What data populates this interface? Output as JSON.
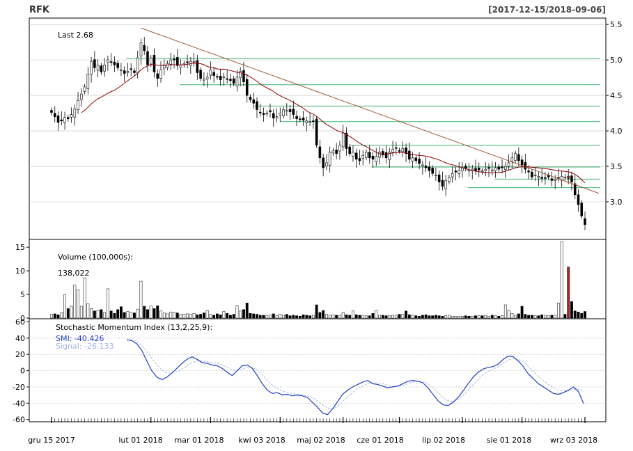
{
  "header": {
    "symbol": "RFK",
    "range": "[2017-12-15/2018-09-06]"
  },
  "chart_data": [
    {
      "type": "candlestick",
      "panel": "price",
      "annotation": "Last 2.68",
      "ylim": [
        2.48,
        5.58
      ],
      "y_ticks": [
        "3.0",
        "3.5",
        "4.0",
        "4.5",
        "5.0",
        "5.5"
      ],
      "x_labels": [
        "gru 15 2017",
        "lut 01 2018",
        "mar 01 2018",
        "kwi 03 2018",
        "maj 02 2018",
        "cze 01 2018",
        "lip 02 2018",
        "sie 01 2018",
        "wrz 03 2018"
      ],
      "closes": [
        4.26,
        4.2,
        4.12,
        4.14,
        4.19,
        4.17,
        4.23,
        4.31,
        4.43,
        4.52,
        4.62,
        4.8,
        4.98,
        4.89,
        4.93,
        4.83,
        4.93,
        5.0,
        4.97,
        4.93,
        4.89,
        4.86,
        4.81,
        4.84,
        4.87,
        4.82,
        5.03,
        5.24,
        5.13,
        4.93,
        5.03,
        4.83,
        4.74,
        4.86,
        4.93,
        4.95,
        5.0,
        5.0,
        4.92,
        4.93,
        4.95,
        4.96,
        4.98,
        4.98,
        4.82,
        4.74,
        4.73,
        4.76,
        4.86,
        4.78,
        4.76,
        4.72,
        4.76,
        4.73,
        4.71,
        4.67,
        4.76,
        4.84,
        4.69,
        4.5,
        4.44,
        4.39,
        4.3,
        4.26,
        4.23,
        4.25,
        4.27,
        4.18,
        4.2,
        4.25,
        4.3,
        4.29,
        4.27,
        4.23,
        4.17,
        4.16,
        4.15,
        4.14,
        4.13,
        4.13,
        3.8,
        3.62,
        3.48,
        3.55,
        3.7,
        3.72,
        3.68,
        3.8,
        3.97,
        3.75,
        3.68,
        3.7,
        3.6,
        3.58,
        3.65,
        3.7,
        3.62,
        3.6,
        3.64,
        3.7,
        3.66,
        3.62,
        3.7,
        3.74,
        3.76,
        3.72,
        3.75,
        3.68,
        3.6,
        3.62,
        3.58,
        3.54,
        3.52,
        3.48,
        3.44,
        3.4,
        3.38,
        3.28,
        3.22,
        3.3,
        3.34,
        3.4,
        3.42,
        3.44,
        3.48,
        3.47,
        3.45,
        3.46,
        3.44,
        3.45,
        3.44,
        3.46,
        3.47,
        3.45,
        3.48,
        3.46,
        3.48,
        3.5,
        3.55,
        3.62,
        3.68,
        3.58,
        3.52,
        3.46,
        3.42,
        3.35,
        3.38,
        3.36,
        3.33,
        3.34,
        3.35,
        3.3,
        3.32,
        3.34,
        3.36,
        3.35,
        3.33,
        3.28,
        3.1,
        2.96,
        2.8,
        2.68
      ],
      "volume_ticks": [
        "0",
        "5",
        "10",
        "15"
      ],
      "volume": {
        "label": "Volume (100,000s):",
        "last": "138,022",
        "ylim": [
          0,
          16.5
        ],
        "values": [
          0.8,
          0.9,
          0.7,
          1.2,
          5.0,
          2.0,
          2.5,
          7.0,
          6.0,
          2.5,
          8.5,
          3.0,
          2.0,
          1.5,
          1.6,
          1.8,
          1.2,
          6.2,
          1.5,
          1.0,
          1.8,
          2.4,
          1.2,
          1.4,
          1.2,
          1.1,
          1.9,
          7.8,
          2.5,
          1.8,
          2.6,
          2.0,
          2.6,
          1.5,
          1.1,
          0.9,
          1.3,
          1.2,
          1.1,
          0.8,
          0.8,
          0.9,
          0.8,
          1.0,
          0.7,
          0.8,
          1.1,
          1.6,
          0.8,
          0.6,
          0.9,
          0.7,
          1.4,
          1.0,
          0.6,
          0.8,
          2.7,
          1.5,
          1.8,
          3.2,
          1.0,
          0.9,
          0.8,
          0.6,
          0.6,
          0.5,
          0.7,
          0.9,
          0.5,
          0.8,
          0.6,
          0.8,
          0.5,
          0.6,
          0.5,
          0.4,
          0.7,
          0.6,
          0.5,
          0.6,
          2.8,
          1.2,
          1.6,
          0.8,
          0.6,
          0.7,
          0.6,
          0.6,
          1.2,
          0.7,
          0.6,
          1.5,
          0.7,
          0.6,
          0.6,
          0.5,
          0.5,
          1.0,
          1.6,
          0.6,
          0.6,
          0.5,
          0.5,
          0.6,
          0.6,
          0.8,
          0.8,
          1.5,
          0.7,
          0.6,
          0.5,
          0.4,
          0.6,
          0.7,
          0.5,
          0.5,
          0.6,
          0.5,
          0.4,
          0.5,
          0.6,
          0.4,
          0.4,
          0.4,
          0.4,
          0.5,
          0.4,
          0.4,
          0.5,
          0.5,
          0.5,
          0.5,
          0.4,
          0.6,
          0.5,
          0.4,
          0.5,
          2.8,
          1.6,
          1.0,
          0.6,
          0.9,
          2.5,
          0.8,
          0.6,
          0.6,
          0.5,
          0.5,
          0.7,
          0.6,
          0.5,
          0.6,
          0.6,
          3.2,
          16.2,
          0.8,
          10.8,
          3.5,
          1.5,
          1.3,
          1.0,
          1.4
        ],
        "up_color": "#ffffff",
        "down_color": "#000000",
        "highlight_color": "#b22222"
      },
      "moving_average": {
        "color": "#8b0000"
      },
      "trendline": {
        "color": "#a0522d"
      },
      "horizontal_levels": [
        {
          "y": 5.02,
          "color": "#3cb371"
        },
        {
          "y": 4.65,
          "color": "#3cb371"
        },
        {
          "y": 4.35,
          "color": "#3cb371"
        },
        {
          "y": 4.13,
          "color": "#3cb371"
        },
        {
          "y": 3.8,
          "color": "#3cb371"
        },
        {
          "y": 3.49,
          "color": "#3cb371"
        },
        {
          "y": 3.32,
          "color": "#3cb371"
        },
        {
          "y": 3.2,
          "color": "#3cb371"
        }
      ],
      "colors": {
        "up": "#ffffff",
        "down": "#000000",
        "red": "#b22222",
        "grid": "#c0c0c0",
        "frame": "#000000"
      }
    },
    {
      "type": "line",
      "panel": "indicator",
      "title": "Stochastic Momentum Index (13,2,25,9):",
      "ylim": [
        -62,
        63
      ],
      "y_ticks": [
        "-60",
        "-40",
        "-20",
        "0",
        "20",
        "40",
        "60"
      ],
      "series": [
        {
          "name": "SMI: -40.426",
          "color": "#1f3fbf",
          "dashed": false,
          "values": [
            38,
            37,
            33,
            25,
            12,
            0,
            -8,
            -11,
            -8,
            -3,
            3,
            9,
            14,
            17,
            14,
            10,
            9,
            7,
            6,
            3,
            -2,
            -6,
            0,
            6,
            7,
            3,
            -6,
            -16,
            -24,
            -28,
            -27,
            -30,
            -29,
            -31,
            -30,
            -31,
            -33,
            -39,
            -45,
            -52,
            -54,
            -47,
            -38,
            -29,
            -24,
            -20,
            -17,
            -14,
            -12,
            -16,
            -17,
            -19,
            -21,
            -20,
            -19,
            -16,
            -13,
            -12,
            -13,
            -15,
            -21,
            -29,
            -37,
            -42,
            -43,
            -39,
            -33,
            -25,
            -16,
            -8,
            -2,
            2,
            4,
            5,
            8,
            14,
            18,
            17,
            12,
            5,
            -4,
            -10,
            -16,
            -20,
            -24,
            -28,
            -29,
            -27,
            -24,
            -20,
            -26,
            -40.4
          ]
        },
        {
          "name": "Signal: -26.133",
          "color": "#9fb4e8",
          "dashed": true,
          "values": [
            38,
            38,
            36,
            31,
            24,
            15,
            7,
            1,
            -3,
            -3,
            -1,
            2,
            6,
            10,
            12,
            12,
            11,
            10,
            9,
            7,
            4,
            1,
            0,
            2,
            4,
            4,
            1,
            -5,
            -12,
            -18,
            -22,
            -25,
            -27,
            -28,
            -29,
            -30,
            -31,
            -33,
            -37,
            -42,
            -46,
            -47,
            -44,
            -38,
            -32,
            -27,
            -22,
            -19,
            -16,
            -15,
            -15,
            -16,
            -18,
            -19,
            -19,
            -18,
            -16,
            -14,
            -13,
            -13,
            -16,
            -21,
            -27,
            -33,
            -37,
            -38,
            -36,
            -31,
            -24,
            -17,
            -11,
            -5,
            -1,
            2,
            5,
            9,
            13,
            15,
            14,
            11,
            5,
            -1,
            -7,
            -12,
            -17,
            -21,
            -24,
            -25,
            -25,
            -23,
            -23,
            -26.1
          ]
        }
      ]
    }
  ]
}
